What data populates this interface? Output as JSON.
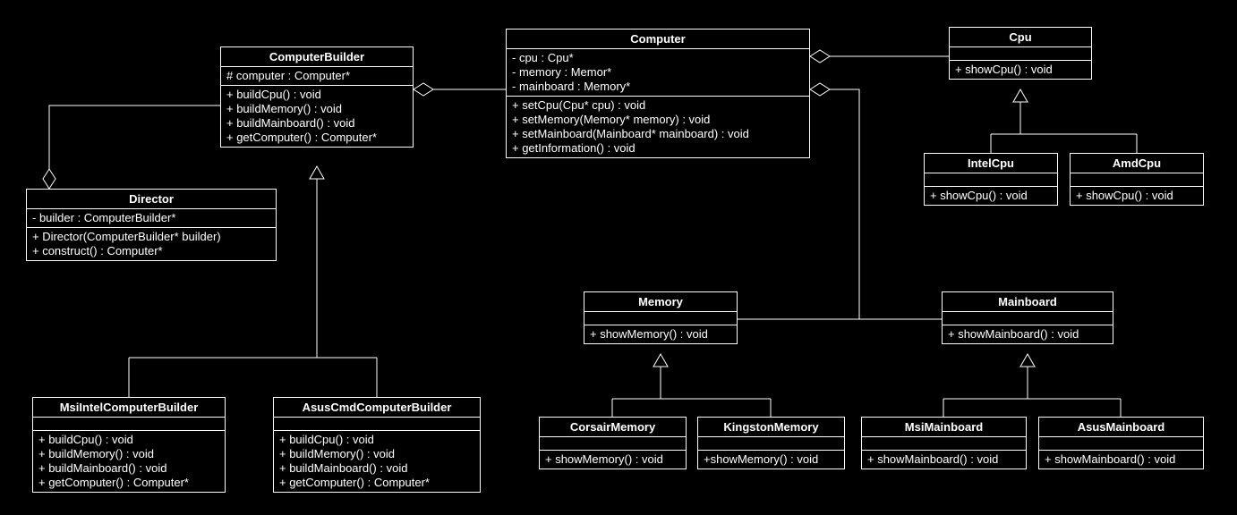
{
  "classes": {
    "ComputerBuilder": {
      "name": "ComputerBuilder",
      "attributes": [
        "# computer : Computer*"
      ],
      "methods": [
        "+ buildCpu() : void",
        "+ buildMemory() : void",
        "+ buildMainboard() : void",
        "+ getComputer() : Computer*"
      ]
    },
    "Computer": {
      "name": "Computer",
      "attributes": [
        "- cpu : Cpu*",
        "- memory : Memor*",
        "- mainboard : Memory*"
      ],
      "methods": [
        "+ setCpu(Cpu* cpu) : void",
        "+ setMemory(Memory* memory) : void",
        "+ setMainboard(Mainboard* mainboard) : void",
        "+ getInformation() : void"
      ]
    },
    "Cpu": {
      "name": "Cpu",
      "attributes": [],
      "methods": [
        "+ showCpu() : void"
      ]
    },
    "IntelCpu": {
      "name": "IntelCpu",
      "attributes": [],
      "methods": [
        "+ showCpu() : void"
      ]
    },
    "AmdCpu": {
      "name": "AmdCpu",
      "attributes": [],
      "methods": [
        "+ showCpu() : void"
      ]
    },
    "Director": {
      "name": "Director",
      "attributes": [
        "- builder : ComputerBuilder*"
      ],
      "methods": [
        "+ Director(ComputerBuilder* builder)",
        "+ construct() : Computer*"
      ]
    },
    "Memory": {
      "name": "Memory",
      "attributes": [],
      "methods": [
        "+ showMemory() : void"
      ]
    },
    "Mainboard": {
      "name": "Mainboard",
      "attributes": [],
      "methods": [
        "+ showMainboard() : void"
      ]
    },
    "MsiIntelComputerBuilder": {
      "name": "MsiIntelComputerBuilder",
      "attributes": [],
      "methods": [
        "+ buildCpu() : void",
        "+ buildMemory() : void",
        "+ buildMainboard() : void",
        "+ getComputer() : Computer*"
      ]
    },
    "AsusCmdComputerBuilder": {
      "name": "AsusCmdComputerBuilder",
      "attributes": [],
      "methods": [
        "+ buildCpu() : void",
        "+ buildMemory() : void",
        "+ buildMainboard() : void",
        "+ getComputer() : Computer*"
      ]
    },
    "CorsairMemory": {
      "name": "CorsairMemory",
      "attributes": [],
      "methods": [
        "+ showMemory() : void"
      ]
    },
    "KingstonMemory": {
      "name": "KingstonMemory",
      "attributes": [],
      "methods": [
        "+showMemory() : void"
      ]
    },
    "MsiMainboard": {
      "name": "MsiMainboard",
      "attributes": [],
      "methods": [
        "+ showMainboard() : void"
      ]
    },
    "AsusMainboard": {
      "name": "AsusMainboard",
      "attributes": [],
      "methods": [
        "+ showMainboard() : void"
      ]
    }
  },
  "relationships": [
    {
      "from": "Director",
      "to": "ComputerBuilder",
      "type": "aggregation"
    },
    {
      "from": "ComputerBuilder",
      "to": "Computer",
      "type": "aggregation"
    },
    {
      "from": "Computer",
      "to": "Cpu",
      "type": "aggregation"
    },
    {
      "from": "Computer",
      "to": "Memory",
      "type": "aggregation"
    },
    {
      "from": "Computer",
      "to": "Mainboard",
      "type": "aggregation"
    },
    {
      "from": "MsiIntelComputerBuilder",
      "to": "ComputerBuilder",
      "type": "generalization"
    },
    {
      "from": "AsusCmdComputerBuilder",
      "to": "ComputerBuilder",
      "type": "generalization"
    },
    {
      "from": "IntelCpu",
      "to": "Cpu",
      "type": "generalization"
    },
    {
      "from": "AmdCpu",
      "to": "Cpu",
      "type": "generalization"
    },
    {
      "from": "CorsairMemory",
      "to": "Memory",
      "type": "generalization"
    },
    {
      "from": "KingstonMemory",
      "to": "Memory",
      "type": "generalization"
    },
    {
      "from": "MsiMainboard",
      "to": "Mainboard",
      "type": "generalization"
    },
    {
      "from": "AsusMainboard",
      "to": "Mainboard",
      "type": "generalization"
    }
  ]
}
